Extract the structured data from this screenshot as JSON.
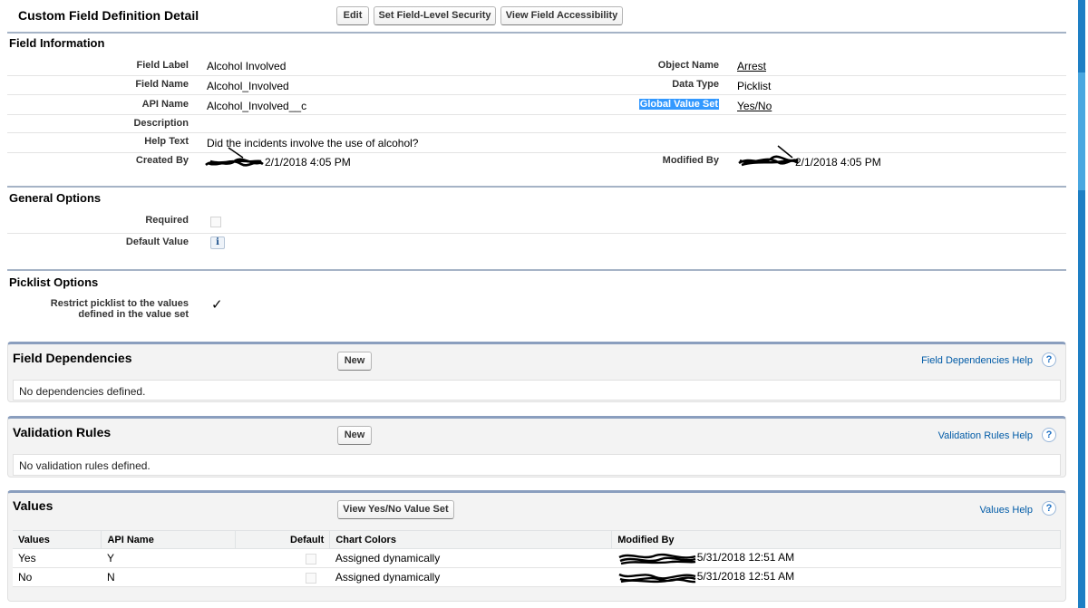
{
  "header": {
    "title": "Custom Field Definition Detail",
    "buttons": {
      "edit": "Edit",
      "security": "Set Field-Level Security",
      "accessibility": "View Field Accessibility"
    }
  },
  "field_information": {
    "title": "Field Information",
    "field_label": {
      "label": "Field Label",
      "value": "Alcohol Involved"
    },
    "field_name": {
      "label": "Field Name",
      "value": "Alcohol_Involved"
    },
    "api_name": {
      "label": "API Name",
      "value": "Alcohol_Involved__c"
    },
    "description": {
      "label": "Description",
      "value": ""
    },
    "help_text": {
      "label": "Help Text",
      "value": "Did the incidents involve the use of alcohol?"
    },
    "created_by": {
      "label": "Created By",
      "value": "2/1/2018 4:05 PM"
    },
    "object_name": {
      "label": "Object Name",
      "value": "Arrest"
    },
    "data_type": {
      "label": "Data Type",
      "value": "Picklist"
    },
    "global_value_set": {
      "label": "Global Value Set",
      "value": "Yes/No"
    },
    "modified_by": {
      "label": "Modified By",
      "value": "2/1/2018 4:05 PM"
    }
  },
  "general_options": {
    "title": "General Options",
    "required_label": "Required",
    "default_value_label": "Default Value",
    "info_icon": "i"
  },
  "picklist_options": {
    "title": "Picklist Options",
    "restrict_label_line1": "Restrict picklist to the values",
    "restrict_label_line2": "defined in the value set",
    "restrict_checked": true,
    "check_glyph": "✓"
  },
  "field_dependencies": {
    "title": "Field Dependencies",
    "new_button": "New",
    "help_link": "Field Dependencies Help",
    "empty_text": "No dependencies defined."
  },
  "validation_rules": {
    "title": "Validation Rules",
    "new_button": "New",
    "help_link": "Validation Rules Help",
    "empty_text": "No validation rules defined."
  },
  "values": {
    "title": "Values",
    "view_button": "View Yes/No Value Set",
    "help_link": "Values Help",
    "columns": [
      "Values",
      "API Name",
      "Default",
      "Chart Colors",
      "Modified By"
    ],
    "rows": [
      {
        "value": "Yes",
        "api_name": "Y",
        "default": false,
        "chart_colors": "Assigned dynamically",
        "modified": "5/31/2018 12:51 AM"
      },
      {
        "value": "No",
        "api_name": "N",
        "default": false,
        "chart_colors": "Assigned dynamically",
        "modified": "5/31/2018 12:51 AM"
      }
    ]
  },
  "help_icon_glyph": "?",
  "colors": {
    "section_bar": "#a5b3c6",
    "link": "#015ba7",
    "highlight": "#3399ff",
    "scrollbar": "#1e7fc4"
  },
  "icons": [
    "info-icon",
    "help-icon",
    "checkmark-icon"
  ]
}
